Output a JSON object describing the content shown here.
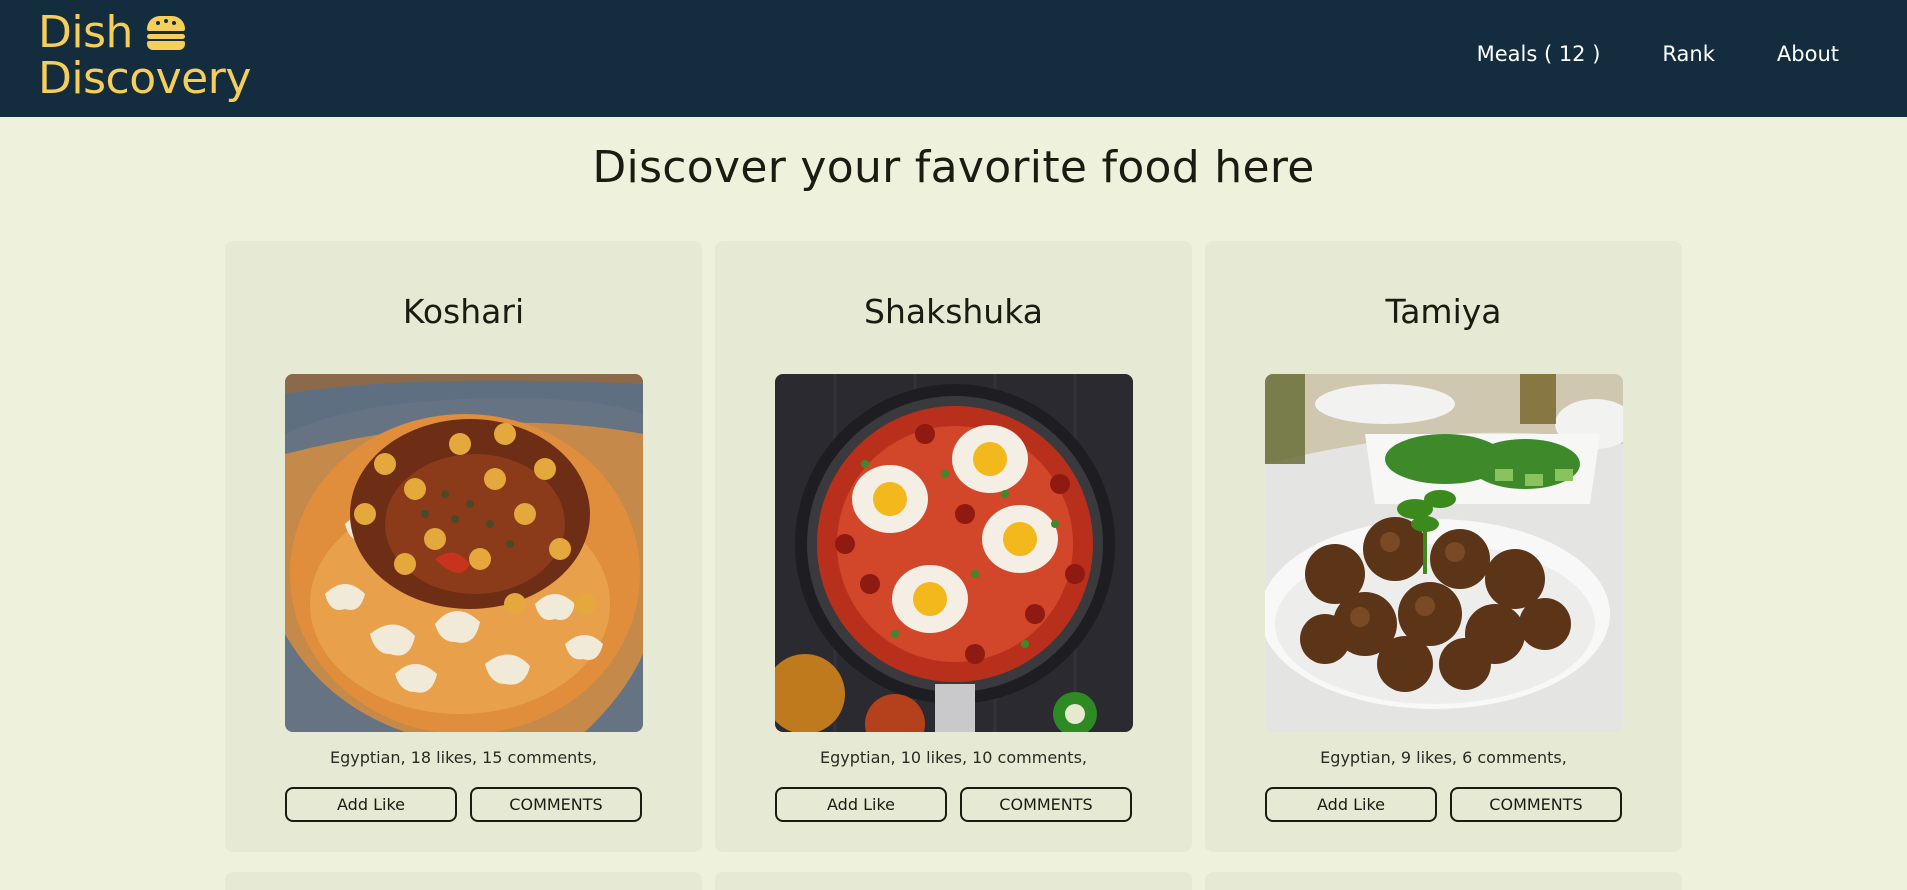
{
  "brand": {
    "line1": "Dish",
    "line2": "Discovery",
    "icon": "hamburger-icon",
    "color": "#f6cf5b"
  },
  "nav": {
    "meals": "Meals ( 12 )",
    "rank": "Rank",
    "about": "About"
  },
  "heading": "Discover your favorite food here",
  "cards": [
    {
      "title": "Koshari",
      "meta": "Egyptian, 18 likes, 15 comments,",
      "like_label": "Add Like",
      "comments_label": "COMMENTS"
    },
    {
      "title": "Shakshuka",
      "meta": "Egyptian, 10 likes, 10 comments,",
      "like_label": "Add Like",
      "comments_label": "COMMENTS"
    },
    {
      "title": "Tamiya",
      "meta": "Egyptian, 9 likes, 6 comments,",
      "like_label": "Add Like",
      "comments_label": "COMMENTS"
    }
  ],
  "colors": {
    "header_bg": "#142d3e",
    "page_bg": "#eef2dc",
    "card_bg": "#e6ead4"
  }
}
